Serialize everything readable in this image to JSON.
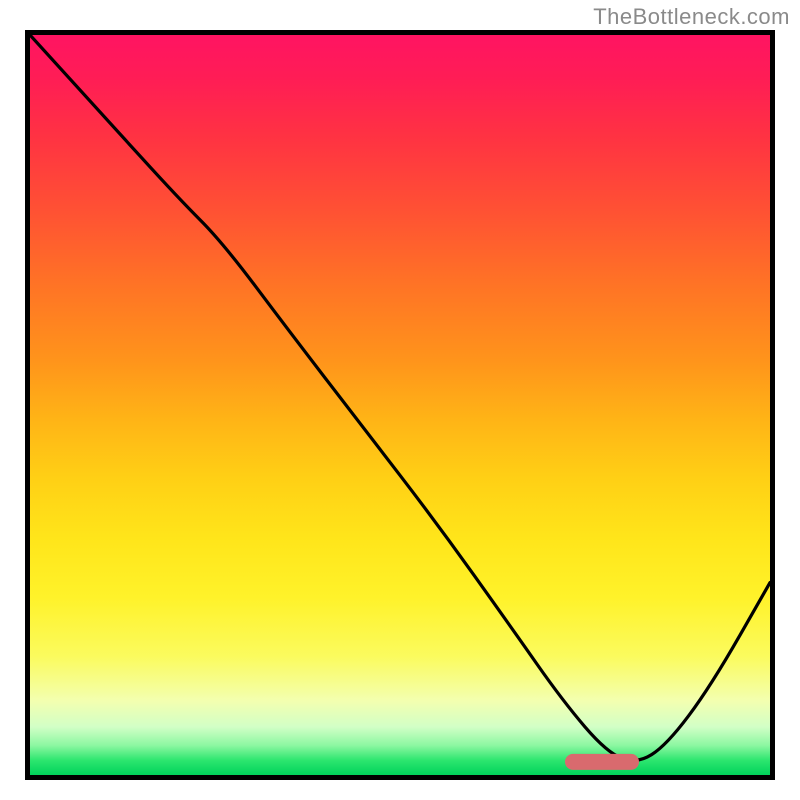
{
  "watermark": "TheBottleneck.com",
  "chart_data": {
    "type": "line",
    "title": "",
    "xlabel": "",
    "ylabel": "",
    "x_range": [
      0,
      1
    ],
    "y_range": [
      0,
      1
    ],
    "ylim": [
      0,
      1
    ],
    "series": [
      {
        "name": "curve",
        "color": "#000000",
        "x": [
          0.0,
          0.1,
          0.2,
          0.26,
          0.35,
          0.45,
          0.55,
          0.65,
          0.72,
          0.78,
          0.82,
          0.86,
          0.92,
          1.0
        ],
        "y": [
          1.0,
          0.89,
          0.78,
          0.72,
          0.6,
          0.47,
          0.34,
          0.2,
          0.1,
          0.03,
          0.015,
          0.04,
          0.12,
          0.26
        ]
      }
    ],
    "marker": {
      "name": "minimum-marker",
      "color": "#d96a6e",
      "x": 0.773,
      "y": 0.018,
      "width_frac": 0.1,
      "height_frac": 0.022
    },
    "background_gradient": {
      "type": "vertical",
      "stops": [
        {
          "pos": 0.0,
          "color": "#ff1462"
        },
        {
          "pos": 0.06,
          "color": "#ff1d55"
        },
        {
          "pos": 0.14,
          "color": "#ff3342"
        },
        {
          "pos": 0.24,
          "color": "#ff5233"
        },
        {
          "pos": 0.34,
          "color": "#ff7425"
        },
        {
          "pos": 0.44,
          "color": "#ff941b"
        },
        {
          "pos": 0.52,
          "color": "#ffb416"
        },
        {
          "pos": 0.6,
          "color": "#ffd015"
        },
        {
          "pos": 0.68,
          "color": "#ffe51a"
        },
        {
          "pos": 0.76,
          "color": "#fff22a"
        },
        {
          "pos": 0.84,
          "color": "#fbfb5e"
        },
        {
          "pos": 0.9,
          "color": "#f3ffb0"
        },
        {
          "pos": 0.935,
          "color": "#d2ffc6"
        },
        {
          "pos": 0.96,
          "color": "#8cf7a1"
        },
        {
          "pos": 0.98,
          "color": "#2de66f"
        },
        {
          "pos": 1.0,
          "color": "#00d35b"
        }
      ]
    }
  }
}
